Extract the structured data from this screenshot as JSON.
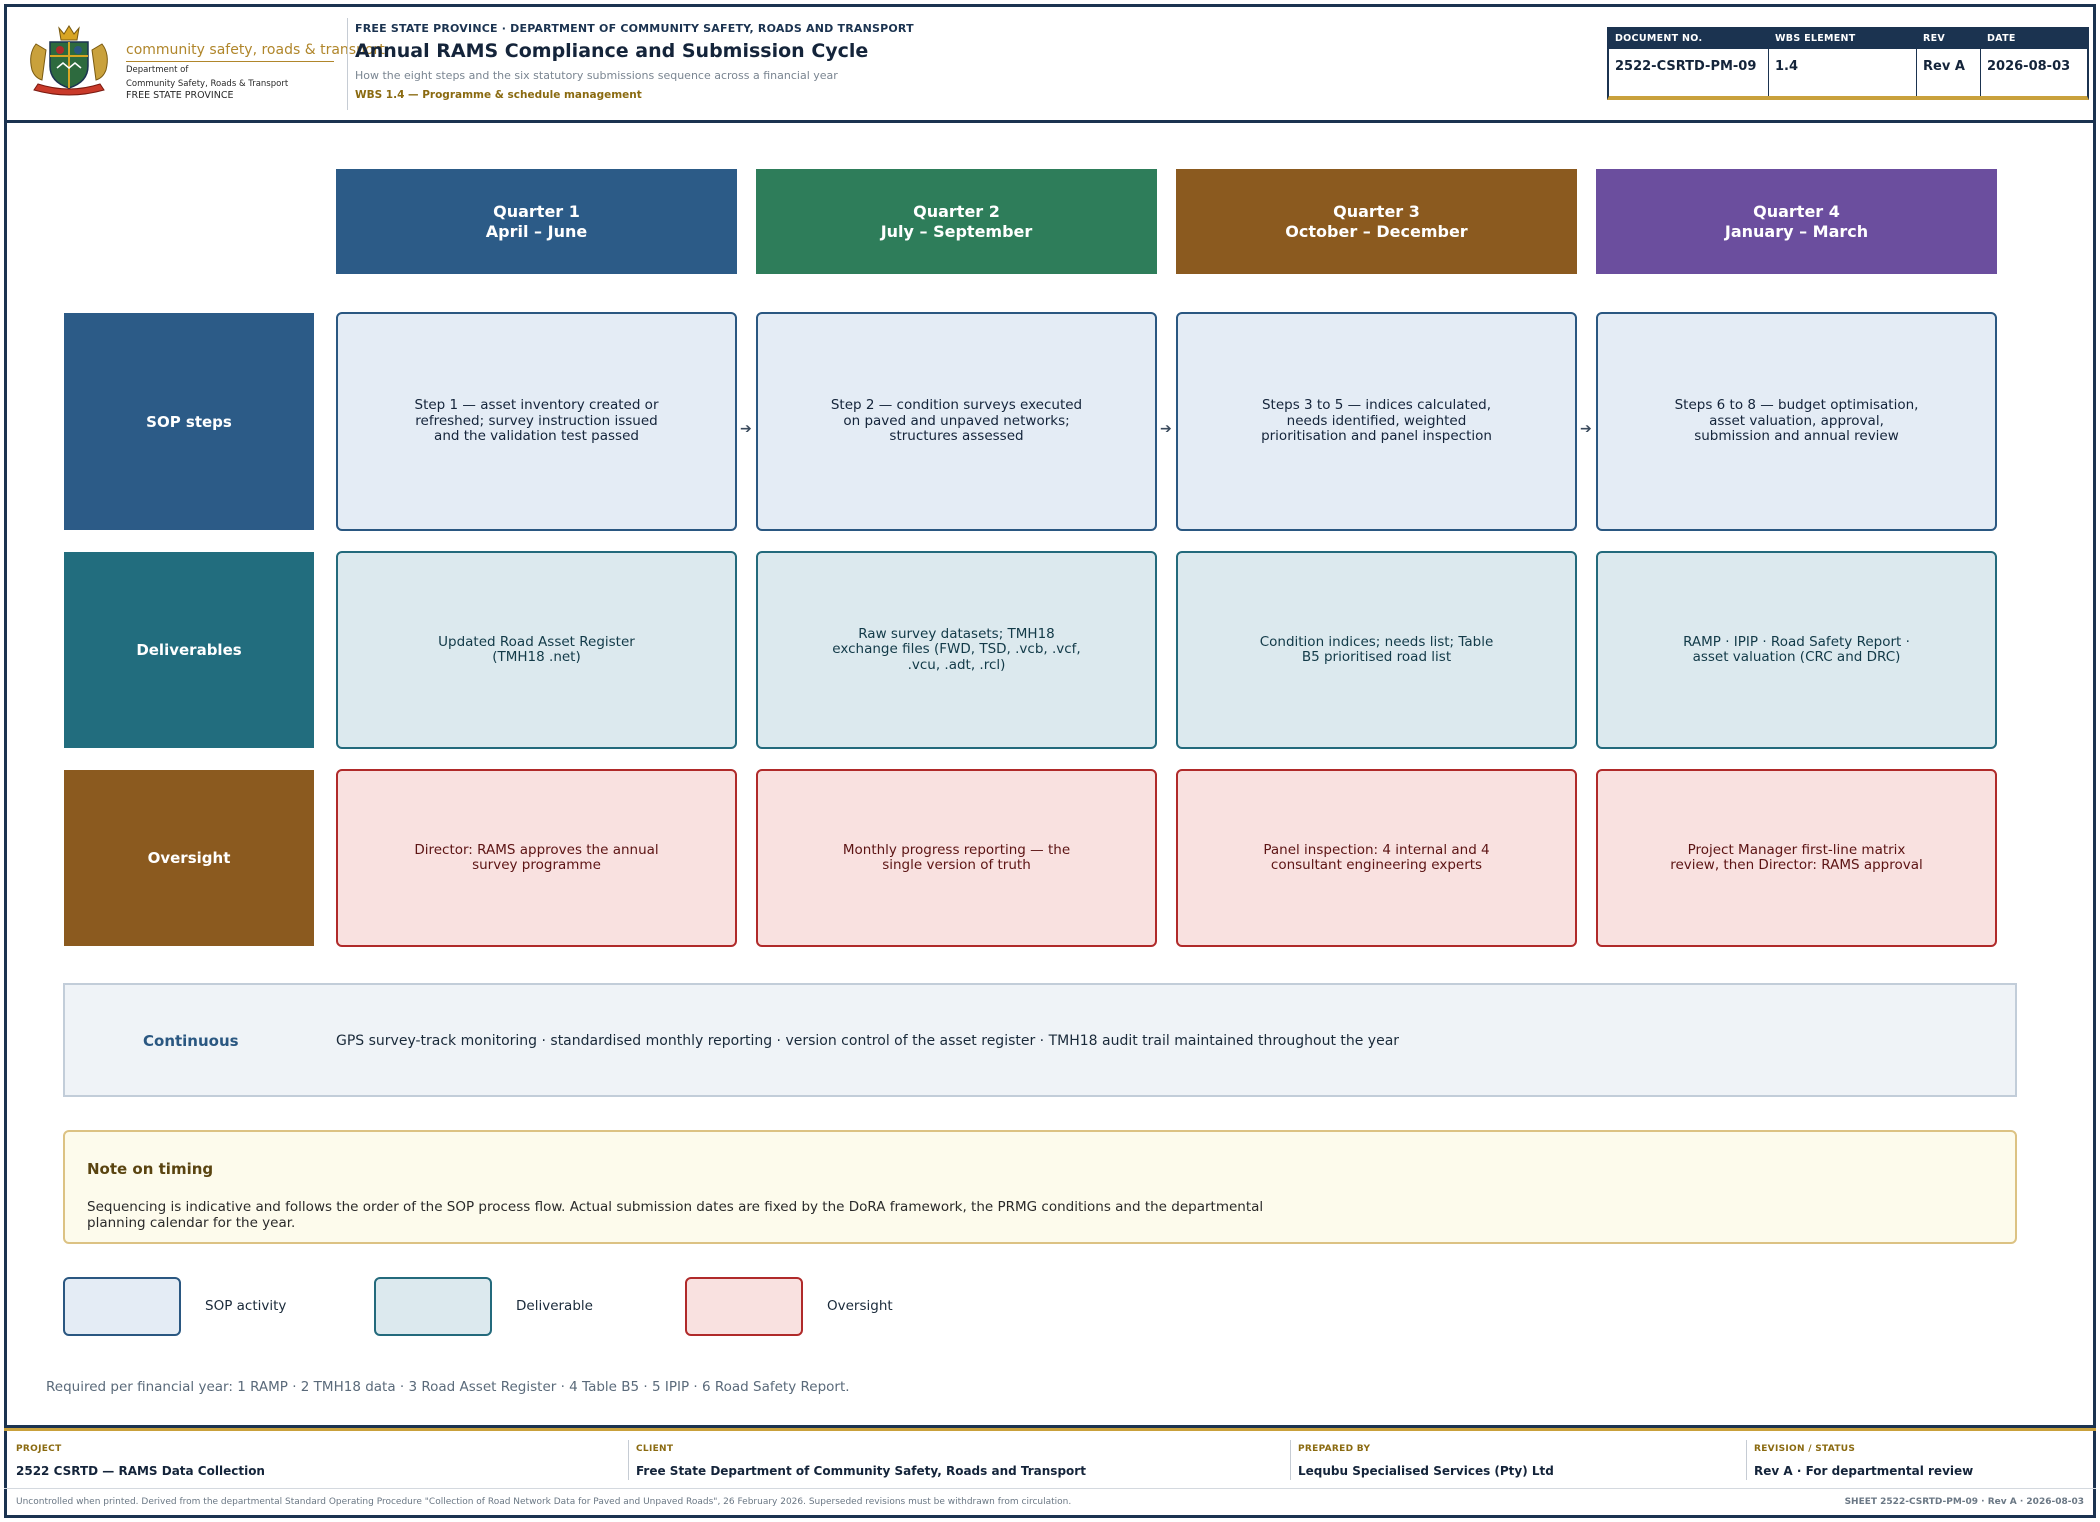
{
  "header": {
    "logo": {
      "line1": "community safety, roads & transport",
      "line2": "Department of",
      "line3": "Community Safety, Roads & Transport",
      "line4": "FREE STATE PROVINCE"
    },
    "department": "FREE STATE PROVINCE · DEPARTMENT OF COMMUNITY SAFETY, ROADS AND TRANSPORT",
    "title": "Annual RAMS Compliance and Submission Cycle",
    "subtitle": "How the eight steps and the six statutory submissions sequence across a financial year",
    "wbs_tag": "WBS 1.4 — Programme & schedule management",
    "meta": [
      {
        "label": "DOCUMENT NO.",
        "value": "2522-CSRTD-PM-09"
      },
      {
        "label": "WBS ELEMENT",
        "value": "1.4"
      },
      {
        "label": "REV",
        "value": "Rev A"
      },
      {
        "label": "DATE",
        "value": "2026-08-03"
      }
    ]
  },
  "colors": {
    "q1": "#2c5b87",
    "q2": "#2e7d5a",
    "q3": "#8b5a1f",
    "q4": "#6b4e9e",
    "sop_row": "#2c5b87",
    "deliverables_row": "#226d7e",
    "oversight_row": "#8b5a1f"
  },
  "quarters": [
    {
      "name": "Quarter 1",
      "months": "April – June"
    },
    {
      "name": "Quarter 2",
      "months": "July – September"
    },
    {
      "name": "Quarter 3",
      "months": "October – December"
    },
    {
      "name": "Quarter 4",
      "months": "January – March"
    }
  ],
  "rows": {
    "sop": {
      "label": "SOP steps",
      "cells": [
        "Step 1 — asset inventory created or refreshed; survey instruction issued and the validation test passed",
        "Step 2 — condition surveys executed on paved and unpaved networks; structures assessed",
        "Steps 3 to 5 — indices calculated, needs identified, weighted prioritisation and panel inspection",
        "Steps 6 to 8 — budget optimisation, asset valuation, approval, submission and annual review"
      ]
    },
    "deliverables": {
      "label": "Deliverables",
      "cells": [
        "Updated Road Asset Register (TMH18 .net)",
        "Raw survey datasets; TMH18 exchange files (FWD, TSD, .vcb, .vcf, .vcu, .adt, .rcl)",
        "Condition indices; needs list; Table B5 prioritised road list",
        "RAMP · IPIP · Road Safety Report · asset valuation (CRC and DRC)"
      ]
    },
    "oversight": {
      "label": "Oversight",
      "cells": [
        "Director: RAMS approves the annual survey programme",
        "Monthly progress reporting — the single version of truth",
        "Panel inspection: 4 internal and 4 consultant engineering experts",
        "Project Manager first-line matrix review, then Director: RAMS approval"
      ]
    }
  },
  "continuous": {
    "label": "Continuous",
    "text": "GPS survey-track monitoring · standardised monthly reporting · version control of the asset register · TMH18 audit trail maintained throughout the year"
  },
  "note": {
    "title": "Note on timing",
    "text": "Sequencing is indicative and follows the order of the SOP process flow. Actual submission dates are fixed by the DoRA framework, the PRMG conditions and the departmental planning calendar for the year."
  },
  "legend": [
    {
      "label": "SOP activity"
    },
    {
      "label": "Deliverable"
    },
    {
      "label": "Oversight"
    }
  ],
  "required_line": "Required per financial year: 1 RAMP · 2 TMH18 data · 3 Road Asset Register · 4 Table B5 · 5 IPIP · 6 Road Safety Report.",
  "footer": {
    "project": {
      "label": "PROJECT",
      "value": "2522 CSRTD — RAMS Data Collection"
    },
    "client": {
      "label": "CLIENT",
      "value": "Free State Department of Community Safety, Roads and Transport"
    },
    "prepared_by": {
      "label": "PREPARED BY",
      "value": "Lequbu Specialised Services (Pty) Ltd"
    },
    "revision": {
      "label": "REVISION / STATUS",
      "value": "Rev A · For departmental review"
    },
    "disclaimer": "Uncontrolled when printed. Derived from the departmental Standard Operating Procedure \"Collection of Road Network Data for Paved and Unpaved Roads\", 26 February 2026. Superseded revisions must be withdrawn from circulation.",
    "sheet_ref": "SHEET 2522-CSRTD-PM-09 · Rev A · 2026-08-03"
  }
}
